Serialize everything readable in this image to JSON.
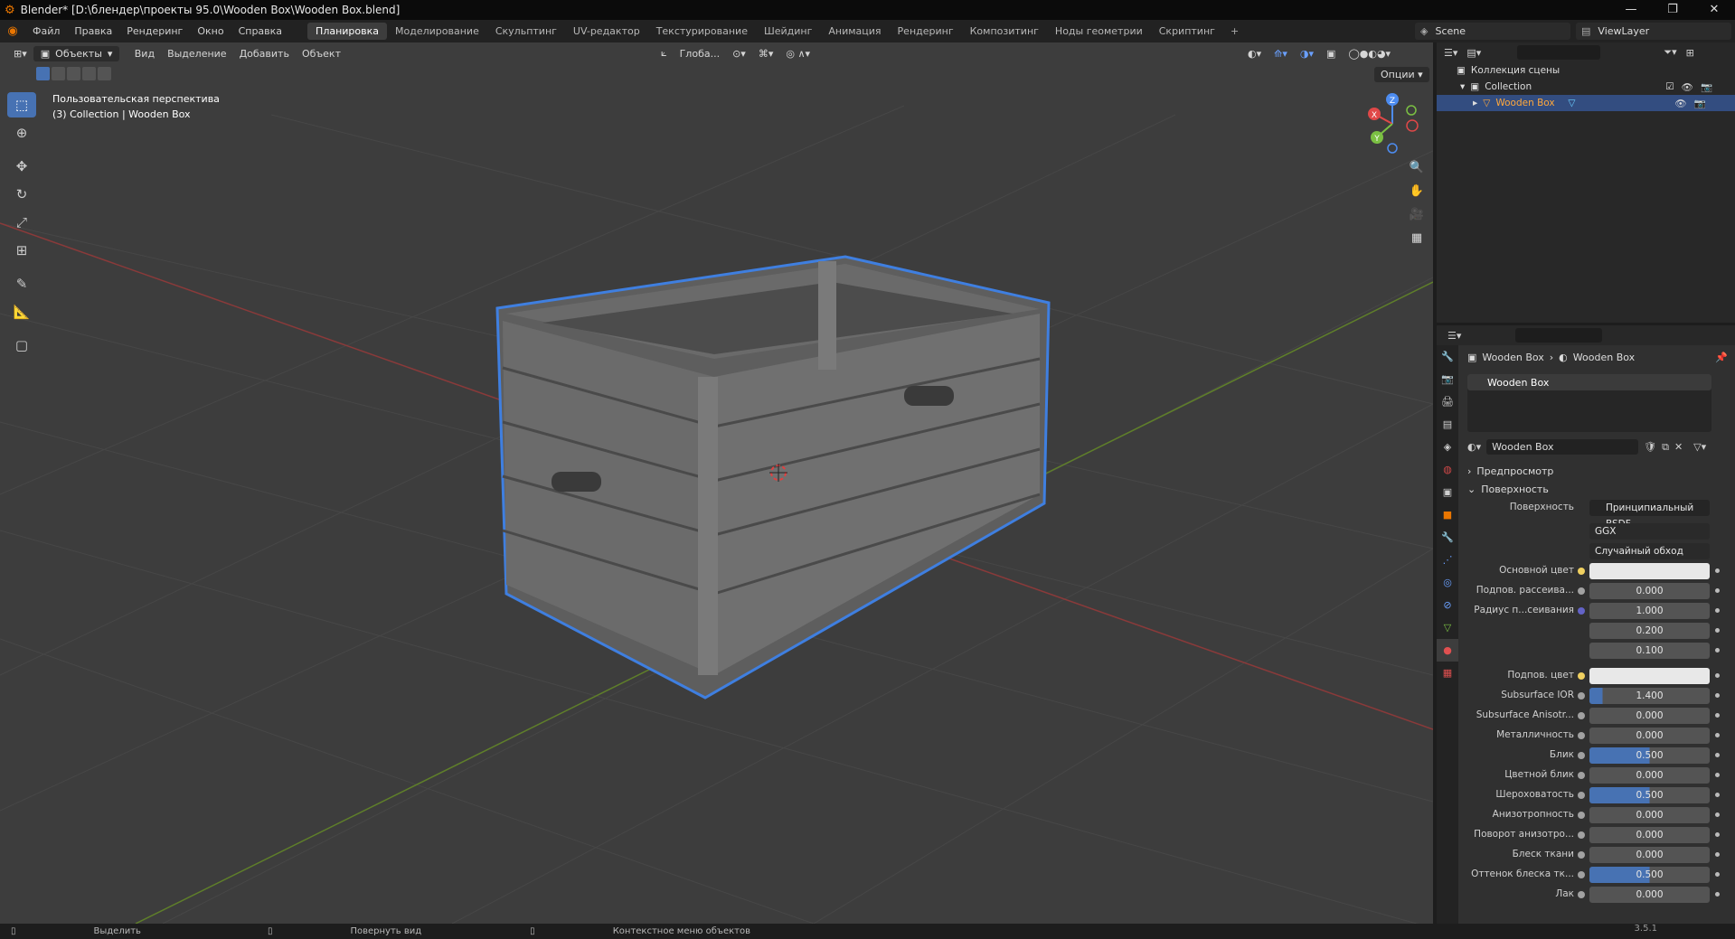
{
  "window": {
    "title": "Blender* [D:\\блендер\\проекты 95.0\\Wooden Box\\Wooden Box.blend]",
    "controls": [
      "—",
      "❐",
      "✕"
    ]
  },
  "menu": {
    "items": [
      "Файл",
      "Правка",
      "Рендеринг",
      "Окно",
      "Справка"
    ],
    "tabs": [
      "Планировка",
      "Моделирование",
      "Скульптинг",
      "UV-редактор",
      "Текстурирование",
      "Шейдинг",
      "Анимация",
      "Рендеринг",
      "Композитинг",
      "Ноды геометрии",
      "Скриптинг"
    ],
    "active_tab": "Планировка",
    "add_tab": "+"
  },
  "scene": {
    "label": "Scene",
    "viewlayer": "ViewLayer"
  },
  "viewport": {
    "mode": "Объекты",
    "header_menus": [
      "Вид",
      "Выделение",
      "Добавить",
      "Объект"
    ],
    "transform_orientation": "Глоба...",
    "options": "Опции",
    "view_name": "Пользовательская перспектива",
    "collection_info": "(3) Collection | Wooden Box",
    "gizmo": {
      "x": "X",
      "y": "Y",
      "z": "Z"
    }
  },
  "outliner": {
    "scene_collection": "Коллекция сцены",
    "collection": "Collection",
    "object": "Wooden Box"
  },
  "properties": {
    "breadcrumb_object": "Wooden Box",
    "breadcrumb_material": "Wooden Box",
    "slot": "Wooden Box",
    "material_name": "Wooden Box",
    "panel_preview": "Предпросмотр",
    "panel_surface": "Поверхность",
    "surface_label": "Поверхность",
    "surface_value": "Принципиальный BSDF",
    "distribution": "GGX",
    "subsurface_method": "Случайный обход",
    "rows": [
      {
        "label": "Основной цвет",
        "value": "",
        "kind": "white",
        "dot": "yellow"
      },
      {
        "label": "Подпов. рассеива...",
        "value": "0.000",
        "kind": "num",
        "dot": "gray"
      },
      {
        "label": "Радиус п...сеивания",
        "value": "1.000",
        "kind": "num",
        "dot": "blue"
      },
      {
        "label": "",
        "value": "0.200",
        "kind": "num",
        "dot": ""
      },
      {
        "label": "",
        "value": "0.100",
        "kind": "num",
        "dot": ""
      },
      {
        "label": "Подпов. цвет",
        "value": "",
        "kind": "white",
        "dot": "yellow"
      },
      {
        "label": "Subsurface IOR",
        "value": "1.400",
        "kind": "low",
        "dot": "gray"
      },
      {
        "label": "Subsurface Anisotr...",
        "value": "0.000",
        "kind": "num",
        "dot": "gray"
      },
      {
        "label": "Металличность",
        "value": "0.000",
        "kind": "num",
        "dot": "gray"
      },
      {
        "label": "Блик",
        "value": "0.500",
        "kind": "fill",
        "dot": "gray"
      },
      {
        "label": "Цветной блик",
        "value": "0.000",
        "kind": "num",
        "dot": "gray"
      },
      {
        "label": "Шероховатость",
        "value": "0.500",
        "kind": "fill",
        "dot": "gray"
      },
      {
        "label": "Анизотропность",
        "value": "0.000",
        "kind": "num",
        "dot": "gray"
      },
      {
        "label": "Поворот анизотро...",
        "value": "0.000",
        "kind": "num",
        "dot": "gray"
      },
      {
        "label": "Блеск ткани",
        "value": "0.000",
        "kind": "num",
        "dot": "gray"
      },
      {
        "label": "Оттенок блеска тк...",
        "value": "0.500",
        "kind": "fill",
        "dot": "gray"
      },
      {
        "label": "Лак",
        "value": "0.000",
        "kind": "num",
        "dot": "gray"
      }
    ]
  },
  "status": {
    "select": "Выделить",
    "rotate": "Повернуть вид",
    "context": "Контекстное меню объектов",
    "version": "3.5.1"
  },
  "colors": {
    "accent": "#4772b3",
    "orange": "#ea7600",
    "selection_outline": "#3f7fe0"
  }
}
